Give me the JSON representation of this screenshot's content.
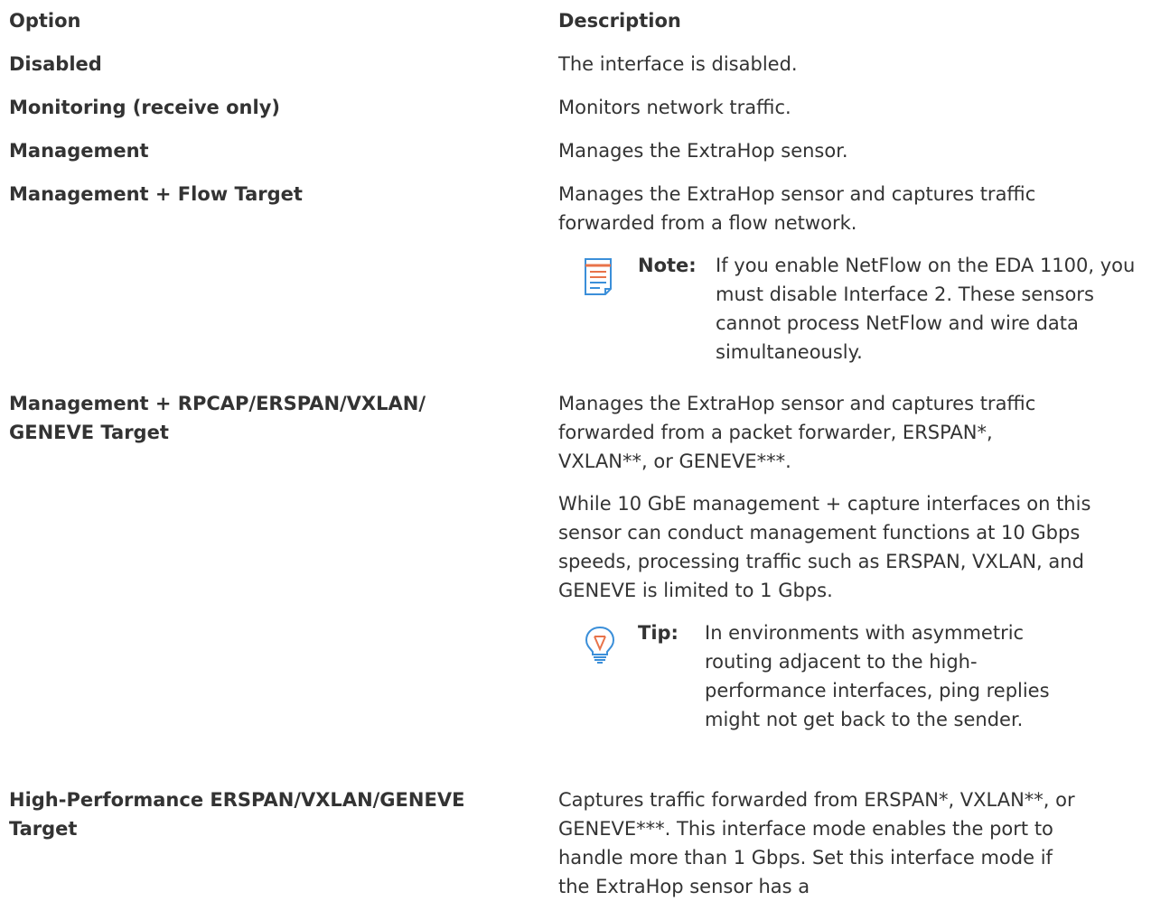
{
  "table": {
    "headers": {
      "option": "Option",
      "description": "Description"
    },
    "rows": [
      {
        "option": "Disabled",
        "description": "The interface is disabled."
      },
      {
        "option": "Monitoring (receive only)",
        "description": "Monitors network traffic."
      },
      {
        "option": "Management",
        "description": "Manages the ExtraHop sensor."
      },
      {
        "option": "Management + Flow Target",
        "description": "Manages the ExtraHop sensor and captures traffic forwarded from a flow network.",
        "note": {
          "label": "Note:",
          "text": "If you enable NetFlow on the EDA 1100, you must disable Interface 2. These sensors cannot process NetFlow and wire data simultaneously.",
          "icon": "note-icon"
        }
      },
      {
        "option": "Management + RPCAP/ERSPAN/VXLAN/ GENEVE Target",
        "description": "Manages the ExtraHop sensor and captures traffic forwarded from a packet forwarder, ERSPAN*, VXLAN**, or GENEVE***.",
        "description_2": "While 10 GbE management + capture interfaces on this sensor can conduct management functions at 10 Gbps speeds, processing traffic such as ERSPAN, VXLAN, and GENEVE is limited to 1 Gbps.",
        "tip": {
          "label": "Tip:",
          "text": "In environments with asymmetric routing adjacent to the high-performance interfaces, ping replies might not get back to the sender.",
          "icon": "lightbulb-icon"
        }
      },
      {
        "option": "High-Performance ERSPAN/VXLAN/GENEVE Target",
        "description": "Captures traffic forwarded from ERSPAN*, VXLAN**, or GENEVE***. This interface mode enables the port to handle more than 1 Gbps. Set this interface mode if the ExtraHop sensor has a"
      }
    ]
  },
  "colors": {
    "text": "#333333",
    "note_icon": "#3b8fd9",
    "note_icon_accent": "#e8734a",
    "tip_icon": "#3b8fd9",
    "tip_icon_accent": "#e8734a"
  }
}
